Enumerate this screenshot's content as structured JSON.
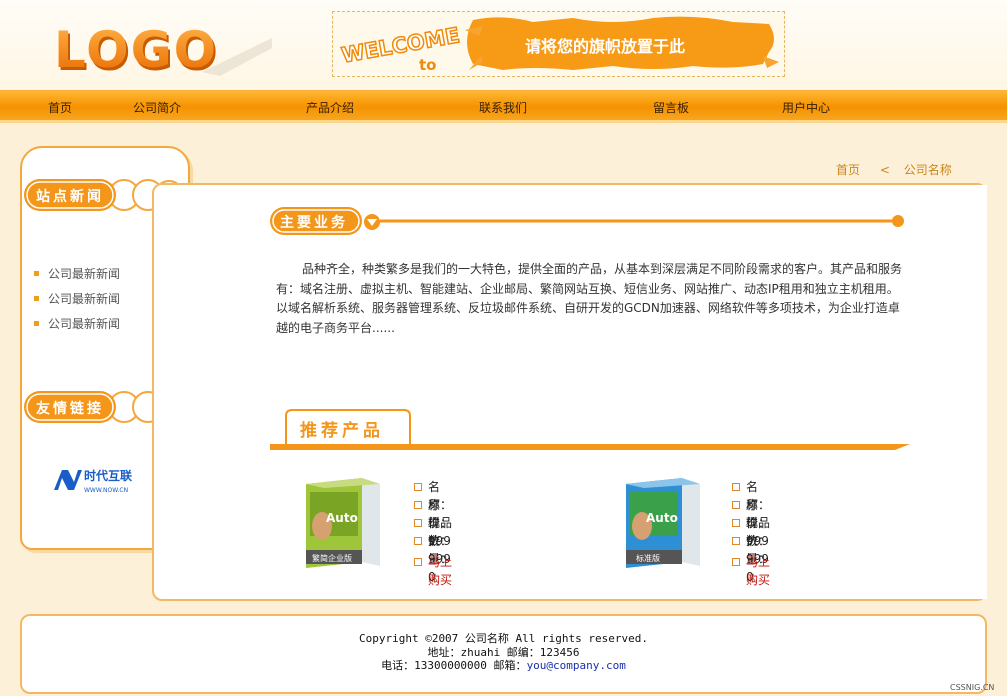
{
  "header": {
    "logo_text": "LOGO",
    "welcome_text": "WELCOME",
    "welcome_to": "to",
    "banner_text": "请将您的旗帜放置于此"
  },
  "nav": {
    "items": [
      {
        "label": "首页"
      },
      {
        "label": "公司简介"
      },
      {
        "label": "产品介绍"
      },
      {
        "label": "联系我们"
      },
      {
        "label": "留言板"
      },
      {
        "label": "用户中心"
      }
    ]
  },
  "sidebar": {
    "news_title": "站点新闻",
    "news_items": [
      "公司最新新闻",
      "公司最新新闻",
      "公司最新新闻"
    ],
    "links_title": "友情链接",
    "partner_name": "时代互联",
    "partner_url_text": "WWW.NOW.CN"
  },
  "breadcrumb": {
    "home": "首页",
    "separator": "<",
    "current": "公司名称"
  },
  "main": {
    "business_title": "主要业务",
    "intro": "品种齐全，种类繁多是我们的一大特色，提供全面的产品，从基本到深层满足不同阶段需求的客户。其产品和服务有：域名注册、虚拟主机、智能建站、企业邮局、繁简网站互换、短信业务、网站推广、动态IP租用和独立主机租用。以域名解析系统、服务器管理系统、反垃圾邮件系统、自研开发的GCDN加速器、网络软件等多项技术，为企业打造卓越的电子商务平台......",
    "recommend_title": "推荐产品",
    "products": [
      {
        "box_label": "繁简企业版",
        "box_brand": "Auto",
        "name": "名称：样品1",
        "original_price": "原价：999",
        "current_price": "现价：999",
        "quantity": "数量：0",
        "buy": "马上购买"
      },
      {
        "box_label": "标准版",
        "box_brand": "Auto",
        "name": "名称：样品",
        "original_price": "原价：999",
        "current_price": "现价：999",
        "quantity": "数量：0",
        "buy": "马上购买"
      }
    ]
  },
  "footer": {
    "copyright": "Copyright ©2007 公司名称 All rights reserved.",
    "address": "地址：zhuahi 邮编：123456",
    "phone_prefix": "电话：13300000000 邮箱：",
    "email": "you@company.com"
  },
  "watermark": "CSSNIG.CN",
  "colors": {
    "accent": "#f59200",
    "accent_light": "#f4b864",
    "background": "#fdf0d8",
    "buy_link": "#c0140c",
    "email_link": "#1a2fb0"
  }
}
